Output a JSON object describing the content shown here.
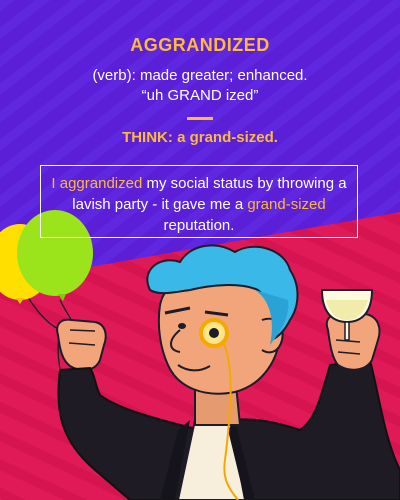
{
  "card": {
    "word": "AGGRANDIZED",
    "definition_line": "(verb): made greater; enhanced.",
    "pronunciation": "“uh GRAND ized”",
    "think_label": "THINK:",
    "think_text": "a grand-sized.",
    "example": {
      "hl1": "I aggrandized",
      "t1": " my social status by throwing a lavish party - it gave me a ",
      "hl2": "grand-sized",
      "t2": " reputation."
    }
  },
  "colors": {
    "top_background": "#5a1fd6",
    "bottom_background": "#e01a57",
    "accent": "#fdba3b",
    "text": "#ffffff"
  },
  "illustration": {
    "subject": "cartoon man with blue hair and monocle raising a champagne glass",
    "balloons": [
      "green-balloon",
      "yellow-balloon"
    ]
  }
}
